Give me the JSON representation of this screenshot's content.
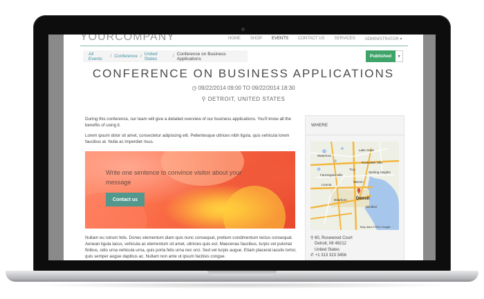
{
  "nav": {
    "logo": "YOURCOMPANY",
    "items": [
      "HOME",
      "SHOP",
      "EVENTS",
      "CONTACT US",
      "SERVICES",
      "ADMINISTRATOR ▾"
    ]
  },
  "breadcrumb": {
    "items": [
      "All Events",
      "Conference",
      "United States"
    ],
    "current": "Conference on Business Applications"
  },
  "status": {
    "label": "Published"
  },
  "event": {
    "title": "CONFERENCE ON BUSINESS APPLICATIONS",
    "dates": "09/22/2014 09:00 TO 09/22/2014 18:30",
    "location": "DETROIT, UNITED STATES"
  },
  "content": {
    "intro": "During this conference, our team will give a detailed overview of our business applications. You'll know all the benefits of using it.",
    "lorem": "Lorem ipsum dolor sit amet, consectetur adipiscing elit. Pellentesque ultrices nibh ligula, quis vehicula lorem faucibus at. Nulla ac imperdiet risus.",
    "hero_text": "Write one sentence to convince visitor about your message",
    "cta": "Contact us",
    "footer_text": "Nullam eu rutrum felis. Donec elementum diam quis nunc consequat, pretium condimentum lectus consequat. Aenean ligula lacus, vehicula ac elementum sit amet, ultricies quis est. Maecenas faucibus, turpis vel pulvinar finibus, odio urna vehicula urna, quis porta felis urna nec orci. Sed vel turpis augue. Etiam placerat iaculis tortor, quis semper augue dapibus ac. Nullam non ante ut ipsum facilisis congue."
  },
  "sidebar": {
    "heading": "WHERE",
    "map_labels": [
      "Waterford",
      "Lake Orion",
      "Rochester Hills",
      "Troy",
      "Farmington Hills",
      "Sterling Heights",
      "Livonia",
      "Detroit",
      "Windsor",
      "Warren",
      "Dearborn"
    ],
    "map_attribution": "Map data ©2014 Google",
    "address": [
      "60, Rosewood Court",
      "Detroit, MI 48212",
      "United States",
      "+1 313 323 3456"
    ]
  },
  "colors": {
    "published": "#3fa46a",
    "cta": "#53988d",
    "accent_line": "#7fb8a8"
  }
}
